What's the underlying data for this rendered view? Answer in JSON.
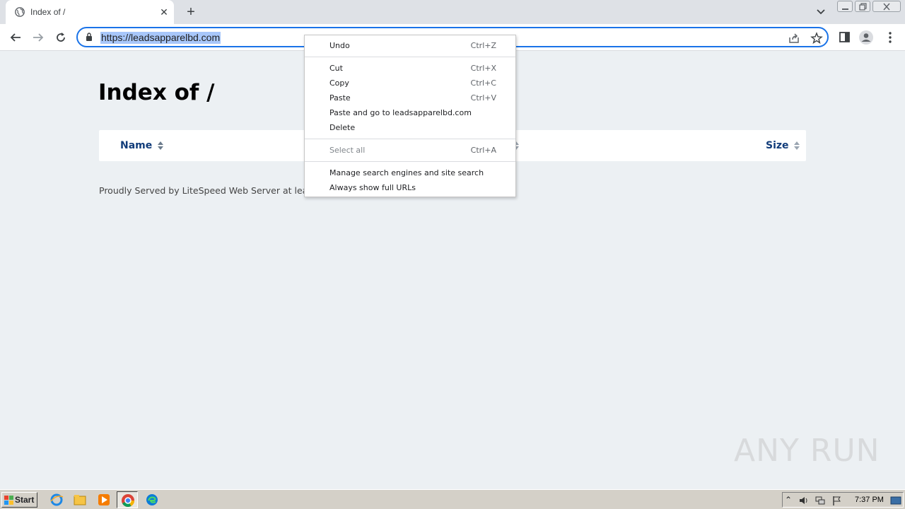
{
  "browser": {
    "tab": {
      "title": "Index of /"
    },
    "address_bar": {
      "url": "https://leadsapparelbd.com"
    }
  },
  "page": {
    "title": "Index of /",
    "columns": [
      {
        "label": "Name"
      },
      {
        "label": "Size"
      }
    ],
    "footer": "Proudly Served by LiteSpeed Web Server at leads"
  },
  "context_menu": {
    "items": [
      {
        "label": "Undo",
        "shortcut": "Ctrl+Z",
        "enabled": true
      },
      {
        "label": "Cut",
        "shortcut": "Ctrl+X",
        "enabled": true
      },
      {
        "label": "Copy",
        "shortcut": "Ctrl+C",
        "enabled": true
      },
      {
        "label": "Paste",
        "shortcut": "Ctrl+V",
        "enabled": true
      },
      {
        "label": "Paste and go to leadsapparelbd.com",
        "shortcut": "",
        "enabled": true
      },
      {
        "label": "Delete",
        "shortcut": "",
        "enabled": true
      },
      {
        "label": "Select all",
        "shortcut": "Ctrl+A",
        "enabled": false
      },
      {
        "label": "Manage search engines and site search",
        "shortcut": "",
        "enabled": true
      },
      {
        "label": "Always show full URLs",
        "shortcut": "",
        "enabled": true
      }
    ]
  },
  "watermark": "ANY RUN",
  "taskbar": {
    "start_label": "Start",
    "clock": "7:37 PM"
  },
  "colors": {
    "accent": "#1a73e8",
    "selection": "#a8c7fa",
    "column_header": "#113c7a",
    "page_bg": "#ecf0f3"
  }
}
